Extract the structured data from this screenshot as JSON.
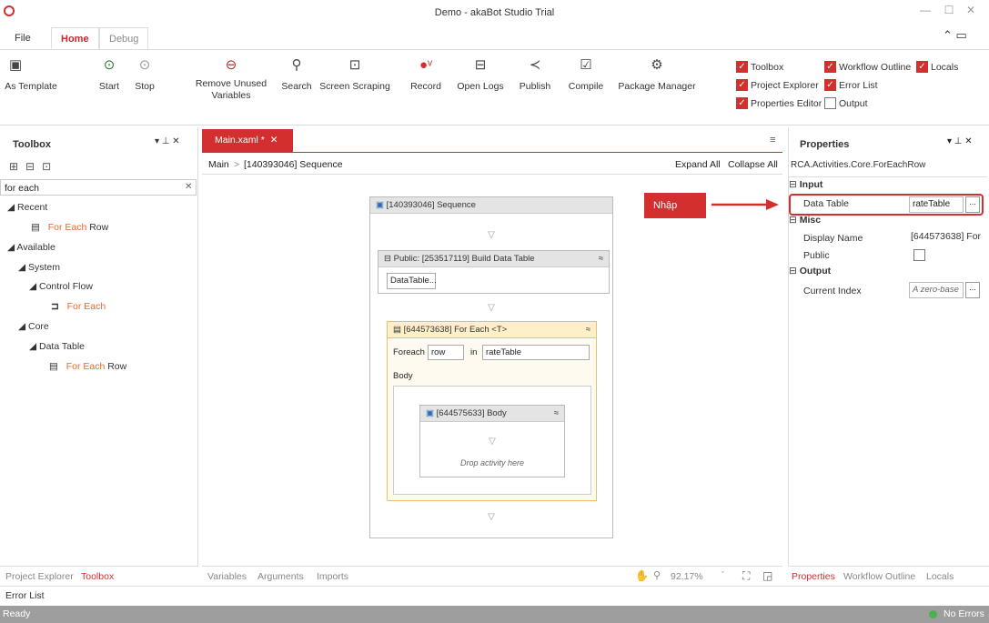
{
  "window": {
    "title": "Demo - akaBot Studio Trial",
    "minimize": "—",
    "maximize": "☐",
    "close": "✕"
  },
  "menu": {
    "file": "File",
    "home": "Home",
    "debug": "Debug"
  },
  "ribbon": {
    "as_template": "As Template",
    "start": "Start",
    "stop": "Stop",
    "remove_unused": "Remove Unused Variables",
    "search": "Search",
    "screen_scraping": "Screen Scraping",
    "record": "Record",
    "open_logs": "Open Logs",
    "publish": "Publish",
    "compile": "Compile",
    "package_manager": "Package Manager"
  },
  "panels_toggle": [
    {
      "label": "Toolbox",
      "checked": true
    },
    {
      "label": "Workflow Outline",
      "checked": true
    },
    {
      "label": "Locals",
      "checked": true
    },
    {
      "label": "Project Explorer",
      "checked": true
    },
    {
      "label": "Error List",
      "checked": true
    },
    {
      "label": "Properties Editor",
      "checked": true
    },
    {
      "label": "Output",
      "checked": false
    }
  ],
  "toolbox": {
    "title": "Toolbox",
    "pin_close": "▾ ⊥ ✕",
    "search_value": "for each",
    "clear": "✕",
    "recent": "Recent",
    "recent_item_highlight": "For Each",
    "recent_item_rest": " Row",
    "available": "Available",
    "system": "System",
    "control_flow": "Control Flow",
    "for_each": "For Each",
    "core": "Core",
    "data_table": "Data Table",
    "for_each_row_highlight": "For Each",
    "for_each_row_rest": " Row"
  },
  "designer": {
    "tab": "Main.xaml *",
    "tab_close": "✕",
    "breadcrumb_root": "Main",
    "breadcrumb_sep": ">",
    "breadcrumb_current": "[140393046] Sequence",
    "expand_all": "Expand All",
    "collapse_all": "Collapse All",
    "sequence": "[140393046] Sequence",
    "build_dt": "Public: [253517119] Build Data Table",
    "build_dt_btn": "DataTable...",
    "for_each": "[644573638] For Each <T>",
    "foreach_label": "Foreach",
    "foreach_var": "row",
    "in_label": "in",
    "in_value": "rateTable",
    "body_label": "Body",
    "body_seq": "[644575633] Body",
    "drop_here": "Drop activity here",
    "zoom": "92.17%",
    "bottom_tabs": [
      "Variables",
      "Arguments",
      "Imports"
    ]
  },
  "annotation": {
    "label": "Nhập"
  },
  "properties": {
    "title": "Properties",
    "pin_close": "▾ ⊥ ✕",
    "type_name": "RCA.Activities.Core.ForEachRow",
    "sec_input": "Input",
    "data_table_label": "Data Table",
    "data_table_value": "rateTable",
    "sec_misc": "Misc",
    "display_name_label": "Display Name",
    "display_name_value": "[644573638] For",
    "public_label": "Public",
    "sec_output": "Output",
    "current_index_label": "Current Index",
    "current_index_placeholder": "A zero-base",
    "ellipsis": "..."
  },
  "bottom_left_tabs": [
    "Project Explorer",
    "Toolbox"
  ],
  "bottom_left_second": "Error List",
  "bottom_right_tabs": [
    "Properties",
    "Workflow Outline",
    "Locals"
  ],
  "status": {
    "left": "Ready",
    "right": "No Errors"
  },
  "colors": {
    "accent": "#d32f2f",
    "highlight": "#e86a2b",
    "foreach_bg": "#fdf3d6",
    "status": "#4caf50"
  }
}
